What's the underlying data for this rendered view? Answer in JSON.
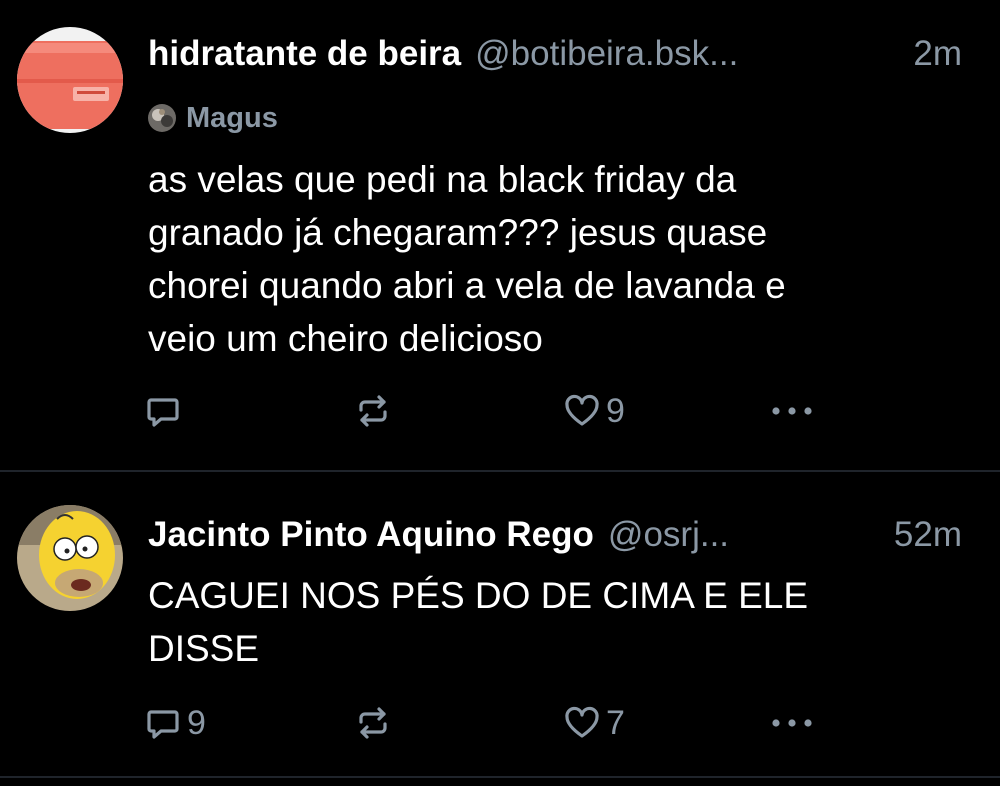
{
  "colors": {
    "background": "#000000",
    "primary_text": "#ffffff",
    "secondary_text": "#8b98a5",
    "divider": "#1f242b"
  },
  "posts": [
    {
      "display_name": "hidratante de beira",
      "handle": "@botibeira.bsk...",
      "time": "2m",
      "reply_to": "Magus",
      "text": "as velas que pedi na black friday da\ngranado já chegaram??? jesus quase\nchorei quando abri a vela de lavanda e\nveio um cheiro delicioso",
      "reply_count": "",
      "like_count": "9",
      "icons": [
        "reply-icon",
        "repost-icon",
        "heart-icon",
        "more-icon"
      ]
    },
    {
      "display_name": "Jacinto Pinto Aquino Rego",
      "handle": "@osrj...",
      "time": "52m",
      "text": "CAGUEI NOS PÉS DO DE CIMA E ELE\nDISSE",
      "reply_count": "9",
      "like_count": "7",
      "icons": [
        "reply-icon",
        "repost-icon",
        "heart-icon",
        "more-icon"
      ]
    }
  ]
}
